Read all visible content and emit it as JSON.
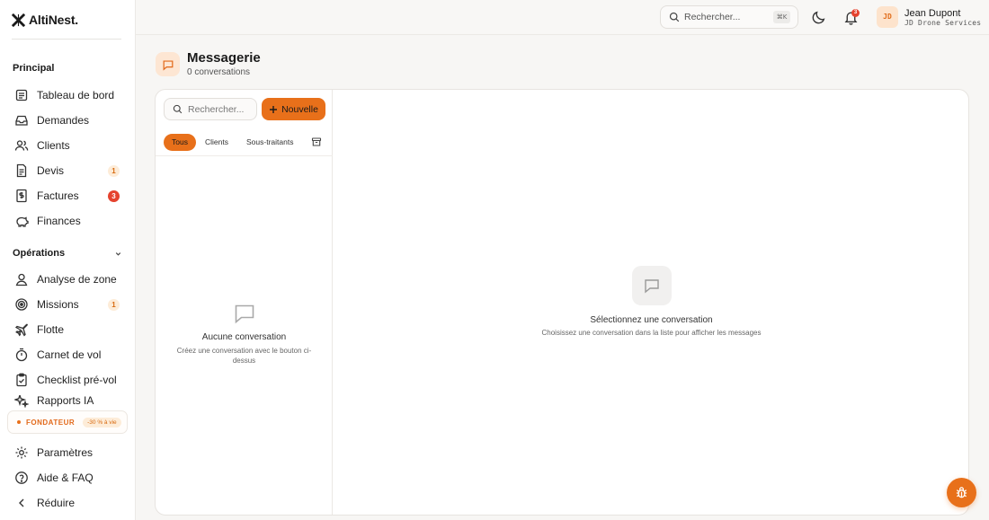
{
  "app": {
    "name": "AltiNest."
  },
  "sidebar": {
    "section_principal": "Principal",
    "principal_items": [
      {
        "label": "Tableau de bord",
        "icon": "dashboard-icon"
      },
      {
        "label": "Demandes",
        "icon": "inbox-icon"
      },
      {
        "label": "Clients",
        "icon": "users-icon"
      },
      {
        "label": "Devis",
        "icon": "document-icon",
        "badge": "1"
      },
      {
        "label": "Factures",
        "icon": "invoice-icon",
        "badge": "3"
      },
      {
        "label": "Finances",
        "icon": "piggy-bank-icon"
      }
    ],
    "section_operations": "Opérations",
    "operations_items": [
      {
        "label": "Analyse de zone",
        "icon": "map-pin-user-icon"
      },
      {
        "label": "Missions",
        "icon": "target-icon",
        "badge": "1"
      },
      {
        "label": "Flotte",
        "icon": "plane-icon"
      },
      {
        "label": "Carnet de vol",
        "icon": "timer-icon"
      },
      {
        "label": "Checklist pré-vol",
        "icon": "clipboard-check-icon"
      },
      {
        "label": "Rapports IA",
        "icon": "sparkles-icon"
      }
    ],
    "founder_label": "FONDATEUR",
    "founder_offer": "-30 % à vie",
    "bottom_items": [
      {
        "label": "Paramètres",
        "icon": "gear-icon"
      },
      {
        "label": "Aide & FAQ",
        "icon": "help-circle-icon"
      },
      {
        "label": "Réduire",
        "icon": "chevron-left-icon"
      }
    ]
  },
  "topbar": {
    "search_placeholder": "Rechercher...",
    "shortcut": "⌘K",
    "notifications_count": "3",
    "avatar_initials": "JD",
    "user_name": "Jean Dupont",
    "user_company": "JD Drone Services"
  },
  "page": {
    "title": "Messagerie",
    "subtitle": "0 conversations"
  },
  "conversations": {
    "search_placeholder": "Rechercher...",
    "new_button": "Nouvelle",
    "tabs": [
      "Tous",
      "Clients",
      "Sous-traitants"
    ],
    "active_tab": "Tous",
    "empty_title": "Aucune conversation",
    "empty_desc": "Créez une conversation avec le bouton ci-dessus"
  },
  "detail": {
    "empty_title": "Sélectionnez une conversation",
    "empty_desc": "Choisissez une conversation dans la liste pour afficher les messages"
  },
  "colors": {
    "accent": "#e8701a",
    "badge_red": "#e5432f",
    "badge_soft_bg": "#fdecd8"
  }
}
